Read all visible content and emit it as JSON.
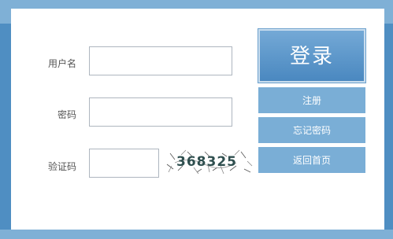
{
  "form": {
    "username_label": "用户名",
    "username_value": "",
    "password_label": "密码",
    "password_value": "",
    "captcha_label": "验证码",
    "captcha_value": "",
    "captcha_text": "368325"
  },
  "buttons": {
    "login": "登录",
    "register": "注册",
    "forgot_password": "忘记密码",
    "back_home": "返回首页"
  },
  "colors": {
    "frame": "#4f8ec2",
    "button": "#7aaed6"
  }
}
